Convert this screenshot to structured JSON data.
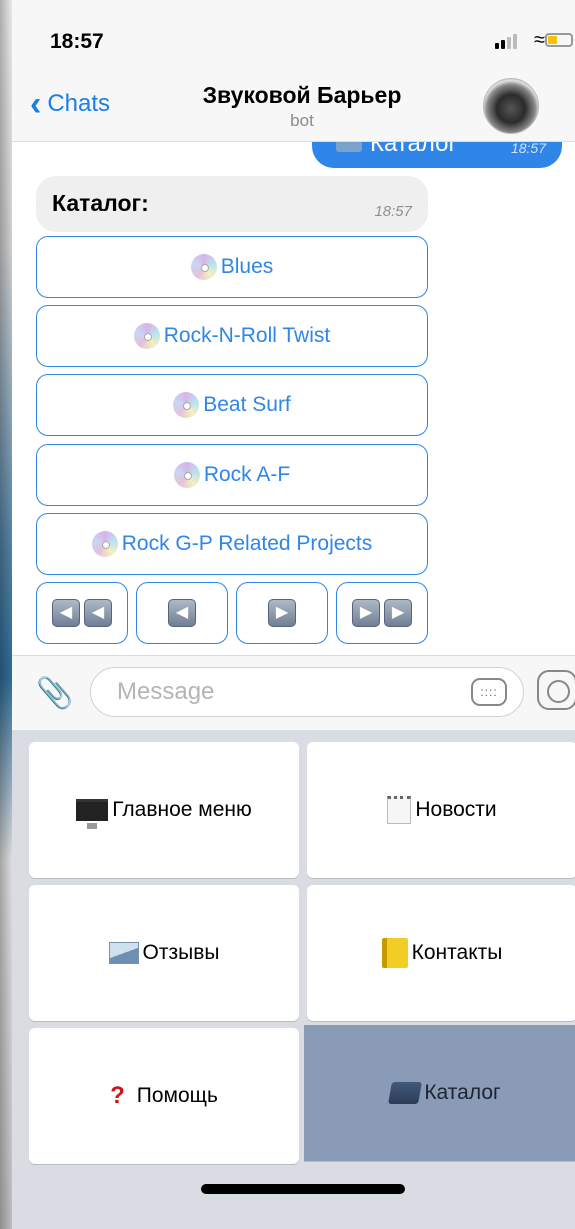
{
  "status": {
    "time": "18:57"
  },
  "header": {
    "back_label": "Chats",
    "title": "Звуковой Барьер",
    "subtitle": "bot"
  },
  "messages": {
    "outgoing": {
      "text": "Каталог",
      "time": "18:57"
    },
    "incoming": {
      "text": "Каталог:",
      "time": "18:57"
    }
  },
  "inline_buttons": [
    {
      "label": "Blues"
    },
    {
      "label": "Rock-N-Roll Twist"
    },
    {
      "label": "Beat Surf"
    },
    {
      "label": "Rock A-F"
    },
    {
      "label": "Rock G-P Related Projects"
    }
  ],
  "input": {
    "placeholder": "Message"
  },
  "reply_keyboard": [
    {
      "label": "Главное меню",
      "icon": "desktop-computer-icon"
    },
    {
      "label": "Новости",
      "icon": "notepad-icon"
    },
    {
      "label": "Отзывы",
      "icon": "incoming-envelope-icon"
    },
    {
      "label": "Контакты",
      "icon": "ledger-icon"
    },
    {
      "label": "Помощь",
      "icon": "question-mark-icon"
    },
    {
      "label": "Каталог",
      "icon": "folder-icon"
    }
  ],
  "colors": {
    "accent": "#2f86e8",
    "active_key": "#8a9bb8"
  }
}
